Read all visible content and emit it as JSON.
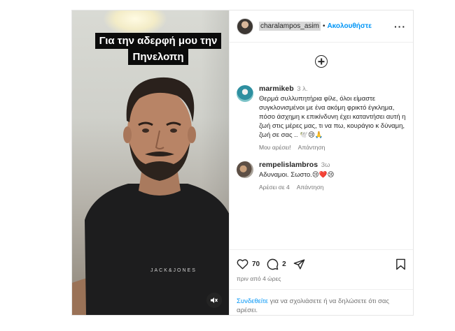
{
  "video": {
    "caption": "Για την αδερφή μου την Πηνελοπη",
    "shirt_text": "JACK&JONES",
    "mute_icon": "speaker-muted-icon"
  },
  "header": {
    "username": "charalampos_asim",
    "separator": "•",
    "follow_label": "Ακολουθήστε",
    "more_icon": "more-horizontal-icon"
  },
  "comments": [
    {
      "username": "marmikeb",
      "time": "3 λ.",
      "text": "Θερμά συλλυπητήρια φίλε, όλοι είμαστε συγκλονισμένοι με ένα ακόμη φρικτό έγκλημα, πόσο άσχημη κ επικίνδυνη έχει καταντήσει αυτή η ζωή στις μέρες μας, τι να πω, κουράγιο κ δύναμη, ζωή σε σας .. 🕊️😢🙏",
      "likes_label": "Μου αρέσει!",
      "reply_label": "Απάντηση"
    },
    {
      "username": "rempelislambros",
      "time": "3ω",
      "text": "Αδυναμοι. Σωστο.😢❤️😢",
      "likes_label": "Αρέσει σε 4",
      "reply_label": "Απάντηση"
    }
  ],
  "actions": {
    "like_count": "70",
    "comment_count": "2",
    "time_ago": "πριν από 4 ώρες"
  },
  "login_prompt": {
    "link": "Συνδεθείτε",
    "rest": " για να σχολιάσετε ή να δηλώσετε ότι σας αρέσει."
  },
  "colors": {
    "accent": "#0095f6",
    "caption_bg": "#0b0b0b",
    "heart": "#ed4956"
  }
}
